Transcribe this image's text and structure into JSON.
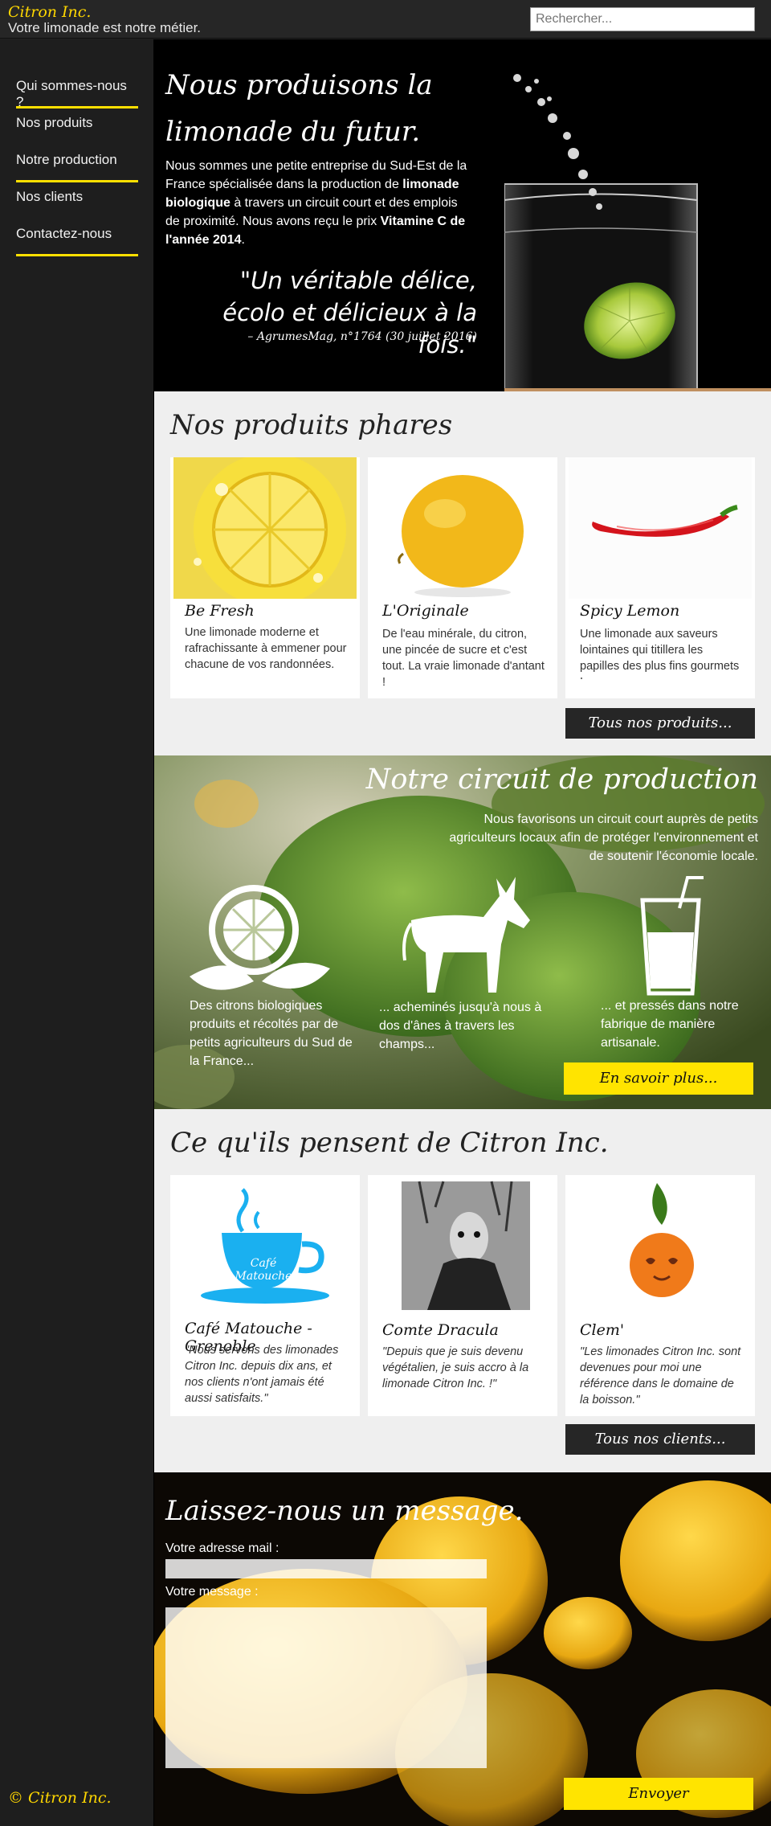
{
  "header": {
    "brand": "Citron Inc.",
    "tagline": "Votre limonade est notre métier.",
    "search_placeholder": "Rechercher..."
  },
  "sidebar": {
    "items": [
      {
        "label": "Qui sommes-nous ?"
      },
      {
        "label": "Nos produits"
      },
      {
        "label": "Notre production"
      },
      {
        "label": "Nos clients"
      },
      {
        "label": "Contactez-nous"
      }
    ],
    "footer_brand": "© Citron Inc."
  },
  "hero": {
    "title": "Nous produisons la limonade du futur.",
    "text_1": "Nous sommes une petite entreprise du Sud-Est de la France spécialisée dans la production de ",
    "text_bold_1": "limonade biologique",
    "text_2": " à travers un circuit court et des emplois de proximité. Nous avons reçu le prix ",
    "text_bold_2": "Vitamine C de l'année 2014",
    "text_3": ".",
    "quote": "\"Un véritable délice, écolo et délicieux à la fois.\"",
    "cite": "– AgrumesMag, n°1764 (30 juillet 2016)"
  },
  "products": {
    "title": "Nos produits phares",
    "items": [
      {
        "name": "Be Fresh",
        "text": "Une limonade moderne et rafrachissante à emmener pour chacune de vos randonnées."
      },
      {
        "name": "L'Originale",
        "text": "De l'eau minérale, du citron, une pincée de sucre et c'est tout. La vraie limonade d'antant !"
      },
      {
        "name": "Spicy Lemon",
        "text": "Une limonade aux saveurs lointaines qui titillera les papilles des plus fins gourmets !"
      }
    ],
    "button": "Tous nos produits..."
  },
  "production": {
    "title": "Notre circuit de production",
    "text": "Nous favorisons un circuit court auprès de petits agriculteurs locaux afin de protéger l'environnement et de soutenir l'économie locale.",
    "steps": [
      {
        "text": "Des citrons biologiques produits et récoltés par  de petits agriculteurs du Sud de la France..."
      },
      {
        "text": "... acheminés jusqu'à nous à dos d'ânes à travers les champs..."
      },
      {
        "text": "... et pressés dans notre fabrique de manière artisanale."
      }
    ],
    "button": "En savoir plus..."
  },
  "clients": {
    "title": "Ce qu'ils pensent de Citron Inc.",
    "items": [
      {
        "name": "Café Matouche - Grenoble",
        "logo_text": "Café Matouche",
        "text": "\"Nous servons des limonades Citron Inc. depuis dix ans, et nos clients n'ont jamais été aussi satisfaits.\""
      },
      {
        "name": "Comte Dracula",
        "text": "\"Depuis que je suis devenu végétalien, je suis accro à la limonade Citron Inc. !\""
      },
      {
        "name": "Clem'",
        "text": "\"Les limonades Citron Inc. sont devenues pour moi une référence dans le domaine de la boisson.\""
      }
    ],
    "button": "Tous nos clients..."
  },
  "contact": {
    "title": "Laissez-nous un message.",
    "email_label": "Votre adresse mail :",
    "message_label": "Votre message :",
    "submit": "Envoyer"
  },
  "colors": {
    "accent": "#ffe400",
    "brand": "#ffd700",
    "dark": "#262626",
    "section_bg": "#efefef"
  }
}
